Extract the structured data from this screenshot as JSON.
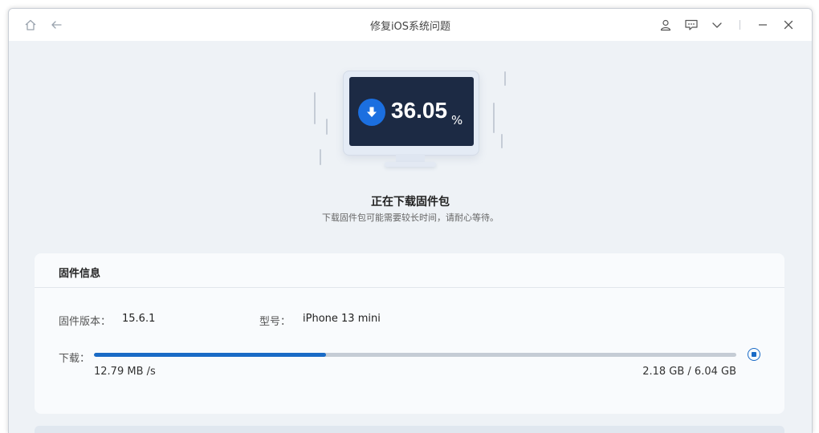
{
  "titlebar": {
    "title": "修复iOS系统问题",
    "icons": [
      "home-icon",
      "back-arrow-icon",
      "user-icon",
      "feedback-icon",
      "chevron-down-icon",
      "minimize-icon",
      "close-icon"
    ]
  },
  "hero": {
    "percent_value": "36.05",
    "percent_sign": "%",
    "progress_fraction": 0.3605,
    "title": "正在下载固件包",
    "subtitle": "下载固件包可能需要较长时间，请耐心等待。"
  },
  "firmware": {
    "section_title": "固件信息",
    "version_label": "固件版本：",
    "version_value": "15.6.1",
    "model_label": "型号：",
    "model_value": "iPhone 13 mini",
    "download_label": "下载：",
    "download_progress": 0.361,
    "speed": "12.79 MB /s",
    "size": "2.18 GB / 6.04 GB"
  },
  "colors": {
    "accent": "#1a6bc6",
    "screen_bg": "#1c2a44",
    "window_bg": "#eef2f6"
  }
}
